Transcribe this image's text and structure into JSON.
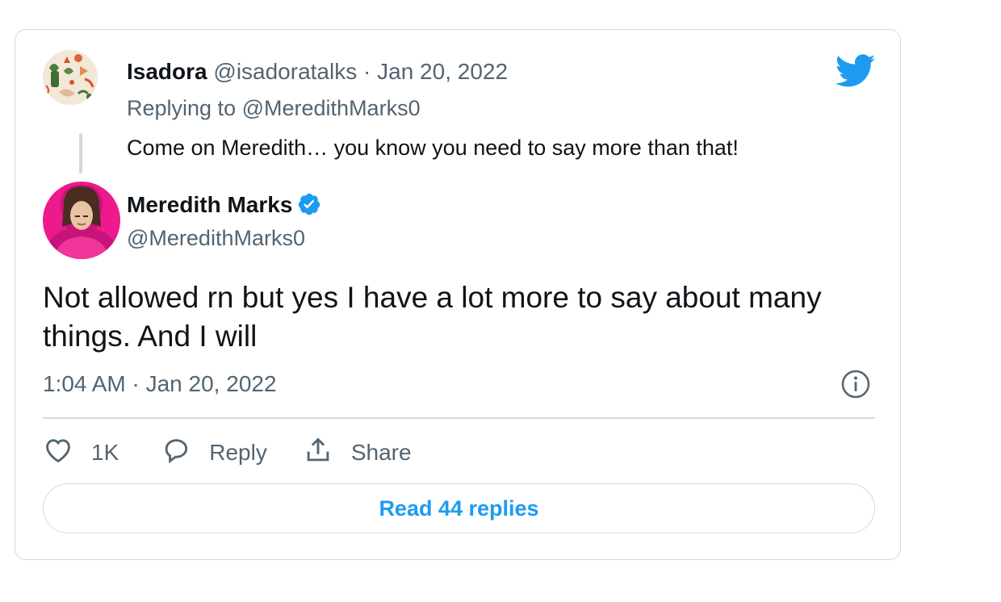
{
  "reply_tweet": {
    "author_name": "Isadora",
    "author_handle": "@isadoratalks",
    "separator": "·",
    "date": "Jan 20, 2022",
    "replying_prefix": "Replying to",
    "replying_handle": "@MeredithMarks0",
    "text": "Come on Meredith… you know you need to say more than that!"
  },
  "main_tweet": {
    "author_name": "Meredith Marks",
    "author_handle": "@MeredithMarks0",
    "verified": true,
    "text": "Not allowed rn but yes I have a lot more to say about many things. And I will",
    "timestamp": "1:04 AM · Jan 20, 2022"
  },
  "actions": {
    "like_count": "1K",
    "reply_label": "Reply",
    "share_label": "Share"
  },
  "read_replies_label": "Read 44 replies",
  "icons": {
    "logo": "twitter-bird-icon",
    "verified": "verified-badge-icon",
    "info": "info-icon",
    "like": "heart-icon",
    "reply": "speech-bubble-icon",
    "share": "share-upload-icon"
  },
  "colors": {
    "brand_blue": "#1d9bf0",
    "text_primary": "#0f1419",
    "text_secondary": "#536471",
    "border": "#cfd9de",
    "avatar_pink": "#ec1a8c"
  }
}
